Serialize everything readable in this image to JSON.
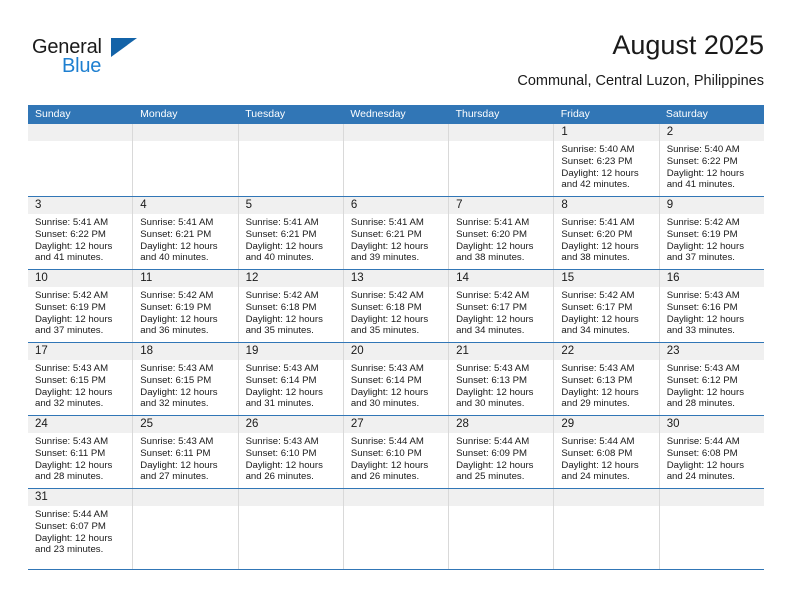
{
  "brand": {
    "name_part1": "General",
    "name_part2": "Blue",
    "triangle_icon": "triangle-icon"
  },
  "header": {
    "title": "August 2025",
    "subtitle": "Communal, Central Luzon, Philippines"
  },
  "colors": {
    "header_blue": "#3176b6",
    "daynum_band": "#f0f0f0",
    "brand_blue": "#1e7fd0",
    "brand_triangle": "#1363a8",
    "cell_border": "#d9d9d9",
    "text": "#1a1a1a"
  },
  "calendar": {
    "weekday_headers": [
      "Sunday",
      "Monday",
      "Tuesday",
      "Wednesday",
      "Thursday",
      "Friday",
      "Saturday"
    ],
    "labels": {
      "sunrise": "Sunrise:",
      "sunset": "Sunset:",
      "daylight": "Daylight:"
    },
    "weeks": [
      [
        {
          "day": "",
          "sunrise": "",
          "sunset": "",
          "daylight_line1": "",
          "daylight_line2": ""
        },
        {
          "day": "",
          "sunrise": "",
          "sunset": "",
          "daylight_line1": "",
          "daylight_line2": ""
        },
        {
          "day": "",
          "sunrise": "",
          "sunset": "",
          "daylight_line1": "",
          "daylight_line2": ""
        },
        {
          "day": "",
          "sunrise": "",
          "sunset": "",
          "daylight_line1": "",
          "daylight_line2": ""
        },
        {
          "day": "",
          "sunrise": "",
          "sunset": "",
          "daylight_line1": "",
          "daylight_line2": ""
        },
        {
          "day": "1",
          "sunrise": "Sunrise: 5:40 AM",
          "sunset": "Sunset: 6:23 PM",
          "daylight_line1": "Daylight: 12 hours",
          "daylight_line2": "and 42 minutes."
        },
        {
          "day": "2",
          "sunrise": "Sunrise: 5:40 AM",
          "sunset": "Sunset: 6:22 PM",
          "daylight_line1": "Daylight: 12 hours",
          "daylight_line2": "and 41 minutes."
        }
      ],
      [
        {
          "day": "3",
          "sunrise": "Sunrise: 5:41 AM",
          "sunset": "Sunset: 6:22 PM",
          "daylight_line1": "Daylight: 12 hours",
          "daylight_line2": "and 41 minutes."
        },
        {
          "day": "4",
          "sunrise": "Sunrise: 5:41 AM",
          "sunset": "Sunset: 6:21 PM",
          "daylight_line1": "Daylight: 12 hours",
          "daylight_line2": "and 40 minutes."
        },
        {
          "day": "5",
          "sunrise": "Sunrise: 5:41 AM",
          "sunset": "Sunset: 6:21 PM",
          "daylight_line1": "Daylight: 12 hours",
          "daylight_line2": "and 40 minutes."
        },
        {
          "day": "6",
          "sunrise": "Sunrise: 5:41 AM",
          "sunset": "Sunset: 6:21 PM",
          "daylight_line1": "Daylight: 12 hours",
          "daylight_line2": "and 39 minutes."
        },
        {
          "day": "7",
          "sunrise": "Sunrise: 5:41 AM",
          "sunset": "Sunset: 6:20 PM",
          "daylight_line1": "Daylight: 12 hours",
          "daylight_line2": "and 38 minutes."
        },
        {
          "day": "8",
          "sunrise": "Sunrise: 5:41 AM",
          "sunset": "Sunset: 6:20 PM",
          "daylight_line1": "Daylight: 12 hours",
          "daylight_line2": "and 38 minutes."
        },
        {
          "day": "9",
          "sunrise": "Sunrise: 5:42 AM",
          "sunset": "Sunset: 6:19 PM",
          "daylight_line1": "Daylight: 12 hours",
          "daylight_line2": "and 37 minutes."
        }
      ],
      [
        {
          "day": "10",
          "sunrise": "Sunrise: 5:42 AM",
          "sunset": "Sunset: 6:19 PM",
          "daylight_line1": "Daylight: 12 hours",
          "daylight_line2": "and 37 minutes."
        },
        {
          "day": "11",
          "sunrise": "Sunrise: 5:42 AM",
          "sunset": "Sunset: 6:19 PM",
          "daylight_line1": "Daylight: 12 hours",
          "daylight_line2": "and 36 minutes."
        },
        {
          "day": "12",
          "sunrise": "Sunrise: 5:42 AM",
          "sunset": "Sunset: 6:18 PM",
          "daylight_line1": "Daylight: 12 hours",
          "daylight_line2": "and 35 minutes."
        },
        {
          "day": "13",
          "sunrise": "Sunrise: 5:42 AM",
          "sunset": "Sunset: 6:18 PM",
          "daylight_line1": "Daylight: 12 hours",
          "daylight_line2": "and 35 minutes."
        },
        {
          "day": "14",
          "sunrise": "Sunrise: 5:42 AM",
          "sunset": "Sunset: 6:17 PM",
          "daylight_line1": "Daylight: 12 hours",
          "daylight_line2": "and 34 minutes."
        },
        {
          "day": "15",
          "sunrise": "Sunrise: 5:42 AM",
          "sunset": "Sunset: 6:17 PM",
          "daylight_line1": "Daylight: 12 hours",
          "daylight_line2": "and 34 minutes."
        },
        {
          "day": "16",
          "sunrise": "Sunrise: 5:43 AM",
          "sunset": "Sunset: 6:16 PM",
          "daylight_line1": "Daylight: 12 hours",
          "daylight_line2": "and 33 minutes."
        }
      ],
      [
        {
          "day": "17",
          "sunrise": "Sunrise: 5:43 AM",
          "sunset": "Sunset: 6:15 PM",
          "daylight_line1": "Daylight: 12 hours",
          "daylight_line2": "and 32 minutes."
        },
        {
          "day": "18",
          "sunrise": "Sunrise: 5:43 AM",
          "sunset": "Sunset: 6:15 PM",
          "daylight_line1": "Daylight: 12 hours",
          "daylight_line2": "and 32 minutes."
        },
        {
          "day": "19",
          "sunrise": "Sunrise: 5:43 AM",
          "sunset": "Sunset: 6:14 PM",
          "daylight_line1": "Daylight: 12 hours",
          "daylight_line2": "and 31 minutes."
        },
        {
          "day": "20",
          "sunrise": "Sunrise: 5:43 AM",
          "sunset": "Sunset: 6:14 PM",
          "daylight_line1": "Daylight: 12 hours",
          "daylight_line2": "and 30 minutes."
        },
        {
          "day": "21",
          "sunrise": "Sunrise: 5:43 AM",
          "sunset": "Sunset: 6:13 PM",
          "daylight_line1": "Daylight: 12 hours",
          "daylight_line2": "and 30 minutes."
        },
        {
          "day": "22",
          "sunrise": "Sunrise: 5:43 AM",
          "sunset": "Sunset: 6:13 PM",
          "daylight_line1": "Daylight: 12 hours",
          "daylight_line2": "and 29 minutes."
        },
        {
          "day": "23",
          "sunrise": "Sunrise: 5:43 AM",
          "sunset": "Sunset: 6:12 PM",
          "daylight_line1": "Daylight: 12 hours",
          "daylight_line2": "and 28 minutes."
        }
      ],
      [
        {
          "day": "24",
          "sunrise": "Sunrise: 5:43 AM",
          "sunset": "Sunset: 6:11 PM",
          "daylight_line1": "Daylight: 12 hours",
          "daylight_line2": "and 28 minutes."
        },
        {
          "day": "25",
          "sunrise": "Sunrise: 5:43 AM",
          "sunset": "Sunset: 6:11 PM",
          "daylight_line1": "Daylight: 12 hours",
          "daylight_line2": "and 27 minutes."
        },
        {
          "day": "26",
          "sunrise": "Sunrise: 5:43 AM",
          "sunset": "Sunset: 6:10 PM",
          "daylight_line1": "Daylight: 12 hours",
          "daylight_line2": "and 26 minutes."
        },
        {
          "day": "27",
          "sunrise": "Sunrise: 5:44 AM",
          "sunset": "Sunset: 6:10 PM",
          "daylight_line1": "Daylight: 12 hours",
          "daylight_line2": "and 26 minutes."
        },
        {
          "day": "28",
          "sunrise": "Sunrise: 5:44 AM",
          "sunset": "Sunset: 6:09 PM",
          "daylight_line1": "Daylight: 12 hours",
          "daylight_line2": "and 25 minutes."
        },
        {
          "day": "29",
          "sunrise": "Sunrise: 5:44 AM",
          "sunset": "Sunset: 6:08 PM",
          "daylight_line1": "Daylight: 12 hours",
          "daylight_line2": "and 24 minutes."
        },
        {
          "day": "30",
          "sunrise": "Sunrise: 5:44 AM",
          "sunset": "Sunset: 6:08 PM",
          "daylight_line1": "Daylight: 12 hours",
          "daylight_line2": "and 24 minutes."
        }
      ],
      [
        {
          "day": "31",
          "sunrise": "Sunrise: 5:44 AM",
          "sunset": "Sunset: 6:07 PM",
          "daylight_line1": "Daylight: 12 hours",
          "daylight_line2": "and 23 minutes."
        },
        {
          "day": "",
          "sunrise": "",
          "sunset": "",
          "daylight_line1": "",
          "daylight_line2": ""
        },
        {
          "day": "",
          "sunrise": "",
          "sunset": "",
          "daylight_line1": "",
          "daylight_line2": ""
        },
        {
          "day": "",
          "sunrise": "",
          "sunset": "",
          "daylight_line1": "",
          "daylight_line2": ""
        },
        {
          "day": "",
          "sunrise": "",
          "sunset": "",
          "daylight_line1": "",
          "daylight_line2": ""
        },
        {
          "day": "",
          "sunrise": "",
          "sunset": "",
          "daylight_line1": "",
          "daylight_line2": ""
        },
        {
          "day": "",
          "sunrise": "",
          "sunset": "",
          "daylight_line1": "",
          "daylight_line2": ""
        }
      ]
    ]
  }
}
